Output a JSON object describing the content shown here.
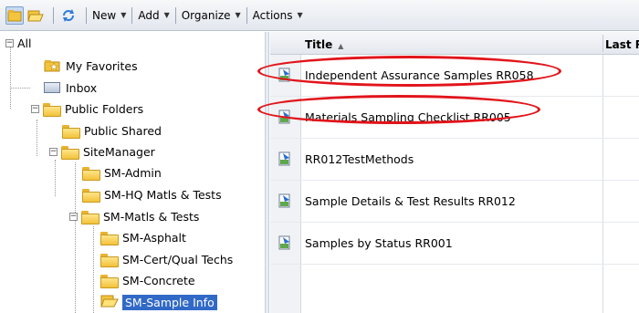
{
  "toolbar": {
    "new_label": "New",
    "add_label": "Add",
    "organize_label": "Organize",
    "actions_label": "Actions"
  },
  "tree": {
    "root": "All",
    "my_favorites": "My Favorites",
    "inbox": "Inbox",
    "public_folders": "Public Folders",
    "public_shared": "Public Shared",
    "site_manager": "SiteManager",
    "sm_admin": "SM-Admin",
    "sm_hq": "SM-HQ Matls & Tests",
    "sm_matls": "SM-Matls & Tests",
    "sm_asphalt": "SM-Asphalt",
    "sm_cert": "SM-Cert/Qual Techs",
    "sm_concrete": "SM-Concrete",
    "sm_sample": "SM-Sample Info"
  },
  "list": {
    "col_title": "Title",
    "col_last": "Last R",
    "rows": [
      "Independent Assurance Samples  RR058",
      "Materials Sampling Checklist  RR005",
      "RR012TestMethods",
      "Sample Details & Test Results  RR012",
      "Samples by Status  RR001"
    ]
  },
  "colors": {
    "selection": "#3169c6",
    "annotation": "#e2141a",
    "folder": "#f2c23b"
  },
  "icons": [
    "folder-view-icon",
    "open-folder-icon",
    "refresh-icon",
    "report-icon",
    "favorites-icon",
    "inbox-icon"
  ]
}
